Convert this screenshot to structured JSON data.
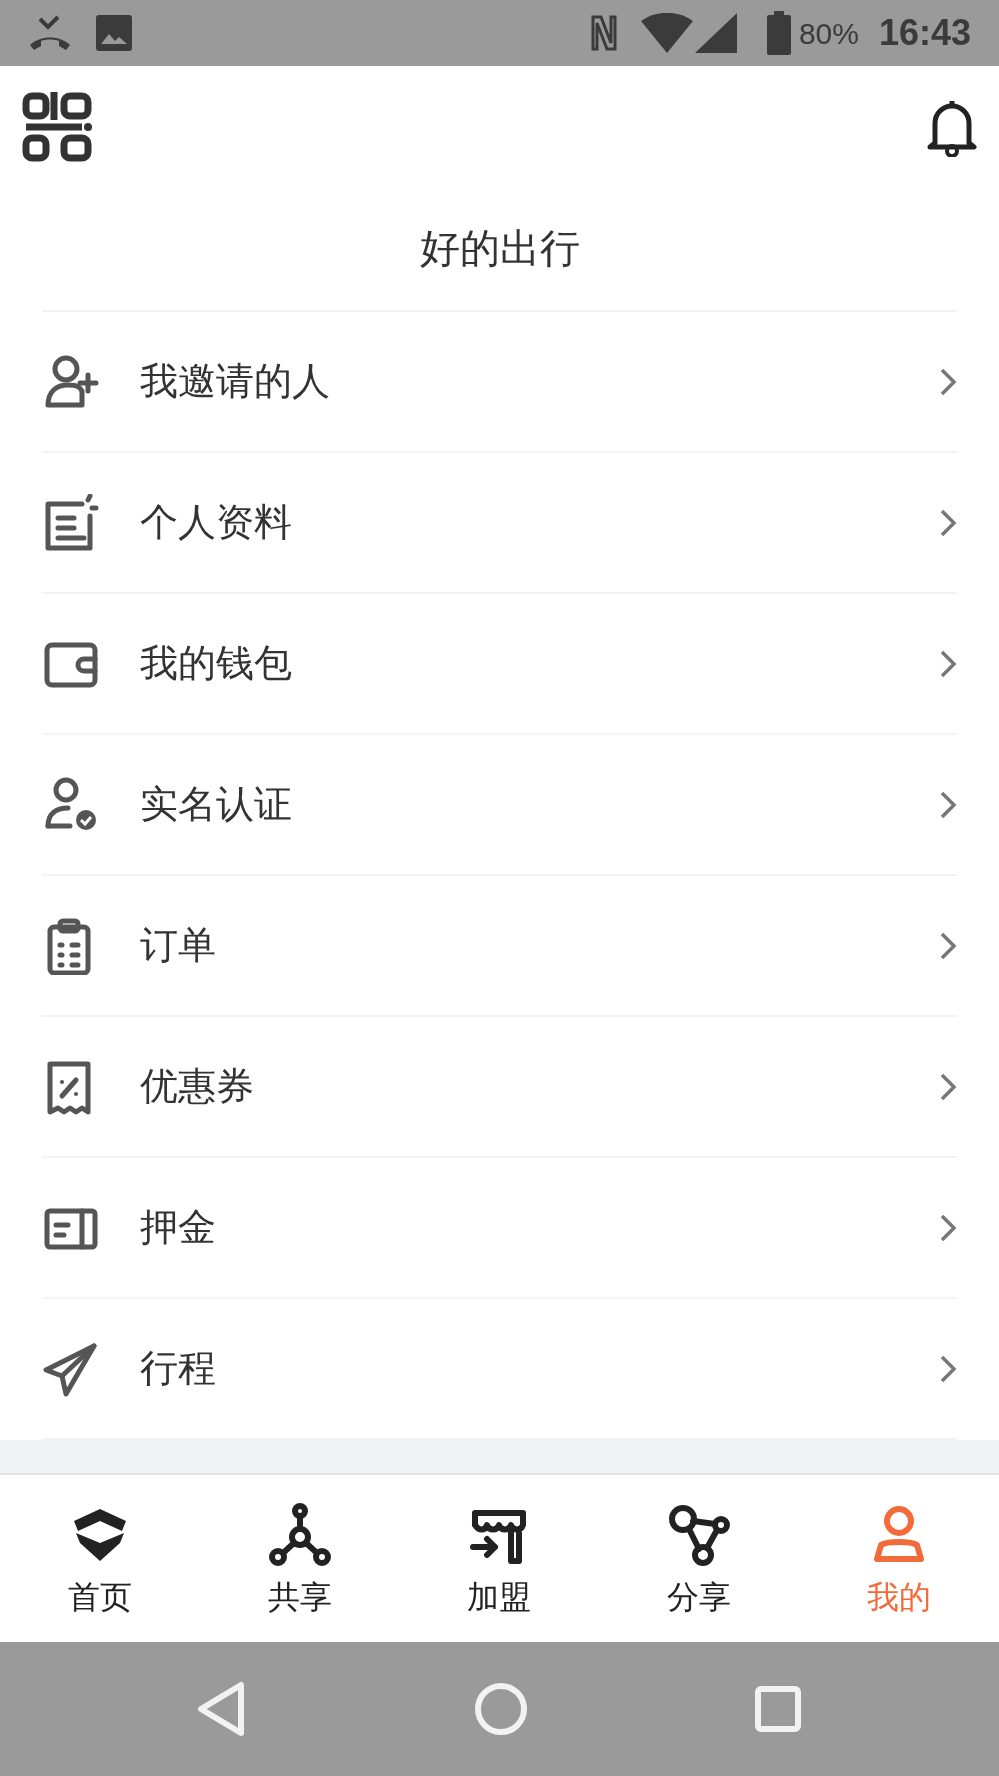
{
  "status_bar": {
    "battery": "80%",
    "time": "16:43"
  },
  "header": {
    "title": "好的出行"
  },
  "menu": [
    {
      "label": "我邀请的人"
    },
    {
      "label": "个人资料"
    },
    {
      "label": "我的钱包"
    },
    {
      "label": "实名认证"
    },
    {
      "label": "订单"
    },
    {
      "label": "优惠券"
    },
    {
      "label": "押金"
    },
    {
      "label": "行程"
    }
  ],
  "tabs": [
    {
      "label": "首页",
      "selected": false
    },
    {
      "label": "共享",
      "selected": false
    },
    {
      "label": "加盟",
      "selected": false
    },
    {
      "label": "分享",
      "selected": false
    },
    {
      "label": "我的",
      "selected": true
    }
  ]
}
